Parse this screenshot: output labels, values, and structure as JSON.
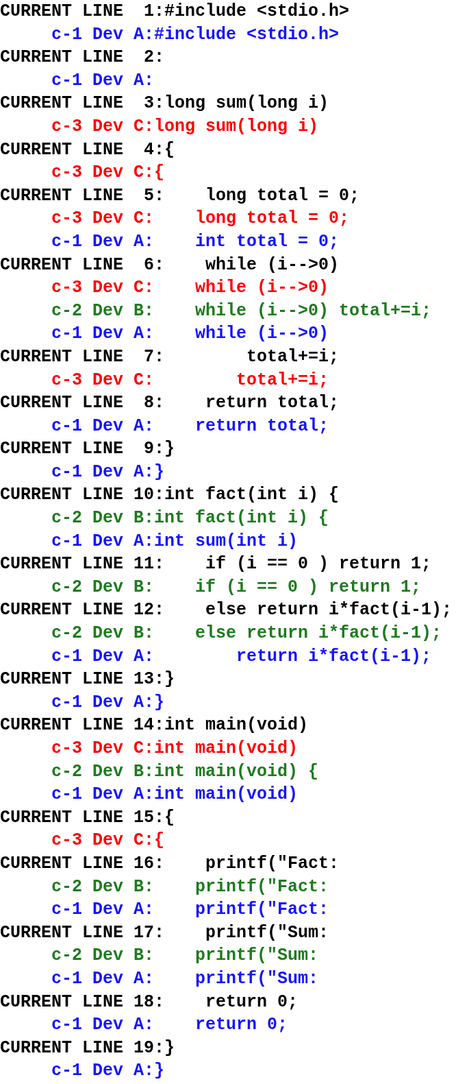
{
  "lines": [
    {
      "label": "CURRENT LINE  1:",
      "code": "#include <stdio.h>",
      "revisions": [
        {
          "label": "c-1 Dev A:",
          "code": "#include <stdio.h>",
          "color": "#1414ff"
        }
      ]
    },
    {
      "label": "CURRENT LINE  2:",
      "revisions": [
        {
          "label": "c-1 Dev A:",
          "color": "#1414ff"
        }
      ]
    },
    {
      "label": "CURRENT LINE  3:",
      "code": "long sum(long i)",
      "revisions": [
        {
          "label": "c-3 Dev C:",
          "code": "long sum(long i)",
          "color": "#ff0000"
        }
      ]
    },
    {
      "label": "CURRENT LINE  4:",
      "code": "{",
      "revisions": [
        {
          "label": "c-3 Dev C:",
          "code": "{",
          "color": "#ff0000"
        }
      ]
    },
    {
      "label": "CURRENT LINE  5:",
      "code": "    long total = 0;",
      "revisions": [
        {
          "label": "c-3 Dev C:",
          "code": "    long total = 0;",
          "color": "#ff0000"
        },
        {
          "label": "c-1 Dev A:",
          "code": "    int total = 0;",
          "color": "#1414ff"
        }
      ]
    },
    {
      "label": "CURRENT LINE  6:",
      "code": "    while (i-->0)",
      "revisions": [
        {
          "label": "c-3 Dev C:",
          "code": "    while (i-->0)",
          "color": "#ff0000"
        },
        {
          "label": "c-2 Dev B:",
          "code": "    while (i-->0) total+=i;",
          "color": "#1e7b1e"
        },
        {
          "label": "c-1 Dev A:",
          "code": "    while (i-->0)",
          "color": "#1414ff"
        }
      ]
    },
    {
      "label": "CURRENT LINE  7:",
      "code": "        total+=i;",
      "revisions": [
        {
          "label": "c-3 Dev C:",
          "code": "        total+=i;",
          "color": "#ff0000"
        }
      ]
    },
    {
      "label": "CURRENT LINE  8:",
      "code": "    return total;",
      "revisions": [
        {
          "label": "c-1 Dev A:",
          "code": "    return total;",
          "color": "#1414ff"
        }
      ]
    },
    {
      "label": "CURRENT LINE  9:",
      "code": "}",
      "revisions": [
        {
          "label": "c-1 Dev A:",
          "code": "}",
          "color": "#1414ff"
        }
      ]
    },
    {
      "label": "CURRENT LINE 10:",
      "code": "int fact(int i) {",
      "revisions": [
        {
          "label": "c-2 Dev B:",
          "code": "int fact(int i) {",
          "color": "#1e7b1e"
        },
        {
          "label": "c-1 Dev A:",
          "code": "int sum(int i)",
          "color": "#1414ff"
        }
      ]
    },
    {
      "label": "CURRENT LINE 11:",
      "code": "    if (i == 0 ) return 1;",
      "revisions": [
        {
          "label": "c-2 Dev B:",
          "code": "    if (i == 0 ) return 1;",
          "color": "#1e7b1e"
        }
      ]
    },
    {
      "label": "CURRENT LINE 12:",
      "code": "    else return i*fact(i-1);",
      "revisions": [
        {
          "label": "c-2 Dev B:",
          "code": "    else return i*fact(i-1);",
          "color": "#1e7b1e"
        },
        {
          "label": "c-1 Dev A:",
          "code": "        return i*fact(i-1);",
          "color": "#1414ff"
        }
      ]
    },
    {
      "label": "CURRENT LINE 13:",
      "code": "}",
      "revisions": [
        {
          "label": "c-1 Dev A:",
          "code": "}",
          "color": "#1414ff"
        }
      ]
    },
    {
      "label": "CURRENT LINE 14:",
      "code": "int main(void)",
      "revisions": [
        {
          "label": "c-3 Dev C:",
          "code": "int main(void)",
          "color": "#ff0000"
        },
        {
          "label": "c-2 Dev B:",
          "code": "int main(void) {",
          "color": "#1e7b1e"
        },
        {
          "label": "c-1 Dev A:",
          "code": "int main(void)",
          "color": "#1414ff"
        }
      ]
    },
    {
      "label": "CURRENT LINE 15:",
      "code": "{",
      "revisions": [
        {
          "label": "c-3 Dev C:",
          "code": "{",
          "color": "#ff0000"
        }
      ]
    },
    {
      "label": "CURRENT LINE 16:",
      "code": "    printf(\"Fact:",
      "revisions": [
        {
          "label": "c-2 Dev B:",
          "code": "    printf(\"Fact:",
          "color": "#1e7b1e"
        },
        {
          "label": "c-1 Dev A:",
          "code": "    printf(\"Fact:",
          "color": "#1414ff"
        }
      ]
    },
    {
      "label": "CURRENT LINE 17:",
      "code": "    printf(\"Sum:",
      "revisions": [
        {
          "label": "c-2 Dev B:",
          "code": "    printf(\"Sum:",
          "color": "#1e7b1e"
        },
        {
          "label": "c-1 Dev A:",
          "code": "    printf(\"Sum:",
          "color": "#1414ff"
        }
      ]
    },
    {
      "label": "CURRENT LINE 18:",
      "code": "    return 0;",
      "revisions": [
        {
          "label": "c-1 Dev A:",
          "code": "    return 0;",
          "color": "#1414ff"
        }
      ]
    },
    {
      "label": "CURRENT LINE 19:",
      "code": "}",
      "revisions": [
        {
          "label": "c-1 Dev A:",
          "code": "}",
          "color": "#1414ff"
        }
      ]
    }
  ]
}
